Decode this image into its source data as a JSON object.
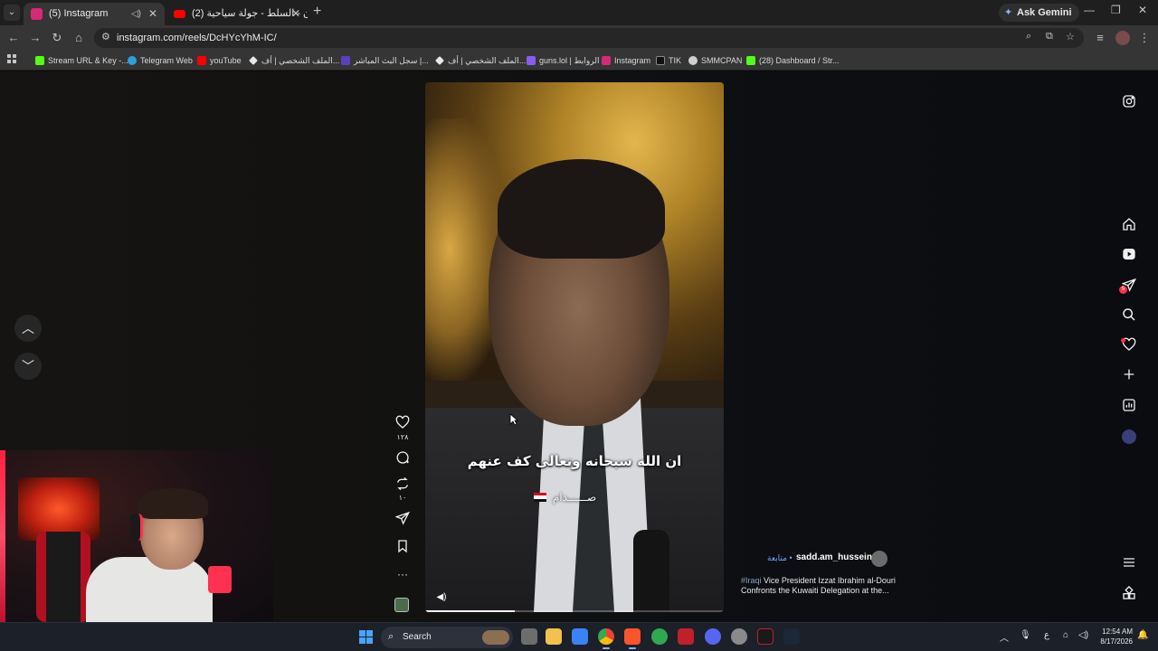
{
  "browser": {
    "tabs": [
      {
        "label": "(5) Instagram",
        "active": true,
        "favicon_color": "#d62976"
      },
      {
        "label": "(2) الأردن - السلط - جولة سياحية",
        "active": false,
        "favicon_color": "#ff0000"
      }
    ],
    "gemini_label": "Ask Gemini",
    "url": "instagram.com/reels/DcHYcYhM-IC/"
  },
  "bookmarks": [
    {
      "label": "Stream URL & Key -...",
      "color": "#53fc18"
    },
    {
      "label": "Telegram Web",
      "color": "#2aa1da"
    },
    {
      "label": "youTube",
      "color": "#ff0000"
    },
    {
      "label": "الملف الشخصي | أف...",
      "color": "#e8e8e8"
    },
    {
      "label": "سجل البث المباشر |...",
      "color": "#5a3fc0"
    },
    {
      "label": "الملف الشخصي | أف...",
      "color": "#e8e8e8"
    },
    {
      "label": "guns.lol | الروابط",
      "color": "#8a5cf0"
    },
    {
      "label": "Instagram",
      "color": "#d62976"
    },
    {
      "label": "TIK",
      "color": "#111111"
    },
    {
      "label": "SMMCPAN",
      "color": "#cfcfcf"
    },
    {
      "label": "(28) Dashboard / Str...",
      "color": "#53fc18"
    }
  ],
  "reel": {
    "caption_line1": "ان الله سبحانه وتعالى كف عنهم",
    "caption_line2": "صــــــدام",
    "like_count": "١٢٨",
    "repost_count": "١٠",
    "username": "sadd.am_hussein12",
    "follow_label": "• متابعة",
    "hashtag": "#Iraqi",
    "description_rest": " Vice President Izzat Ibrahim al-Douri",
    "description_line2": "Confronts the Kuwaiti Delegation at the...",
    "progress": 0.3
  },
  "right_nav": {
    "messages_badge": "5"
  },
  "taskbar": {
    "search_label": "Search",
    "lang": "ع",
    "time": "12:54 AM",
    "date": "8/17/2026"
  },
  "colors": {
    "page_bg": "#0b0b0b",
    "accent_blue": "#6fa8ff",
    "notification_red": "#ff3040"
  }
}
